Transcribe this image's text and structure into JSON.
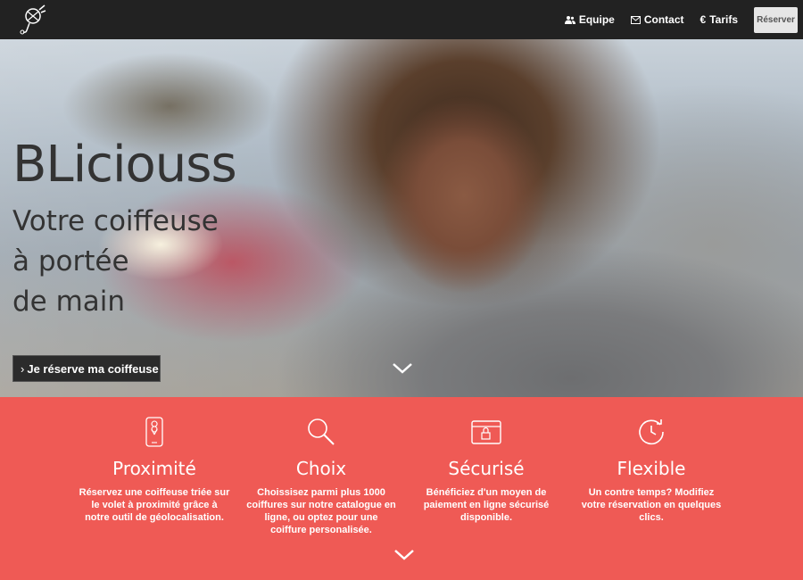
{
  "nav": {
    "logo_icon": "hairdryer-logo",
    "links": [
      {
        "label": "Equipe",
        "icon": "users-icon"
      },
      {
        "label": "Contact",
        "icon": "envelope-icon"
      },
      {
        "label": "Tarifs",
        "icon": "euro-icon"
      }
    ],
    "reserve_label": "Réserver",
    "colors": {
      "background": "#222222",
      "button": "#e6e6e6"
    }
  },
  "hero": {
    "title": "BLiciouss",
    "subtitle_lines": [
      "Votre coiffeuse",
      "à portée",
      "de main"
    ],
    "cta_label": "Je réserve ma coiffeuse",
    "scroll_icon": "chevron-down-icon"
  },
  "features": {
    "background": "#ef5a55",
    "items": [
      {
        "icon": "phone-location-icon",
        "title": "Proximité",
        "text": "Réservez une coiffeuse triée sur le volet à proximité grâce à notre outil de géolocalisation."
      },
      {
        "icon": "magnifier-icon",
        "title": "Choix",
        "text": "Choissisez parmi plus 1000 coiffures sur notre catalogue en ligne, ou optez pour une coiffure personalisée."
      },
      {
        "icon": "secure-wallet-icon",
        "title": "Sécurisé",
        "text": "Bénéficiez d'un moyen de paiement en ligne sécurisé disponible."
      },
      {
        "icon": "clock-refresh-icon",
        "title": "Flexible",
        "text": "Un contre temps? Modifiez votre réservation en quelques clics."
      }
    ],
    "scroll_icon": "chevron-down-icon"
  }
}
